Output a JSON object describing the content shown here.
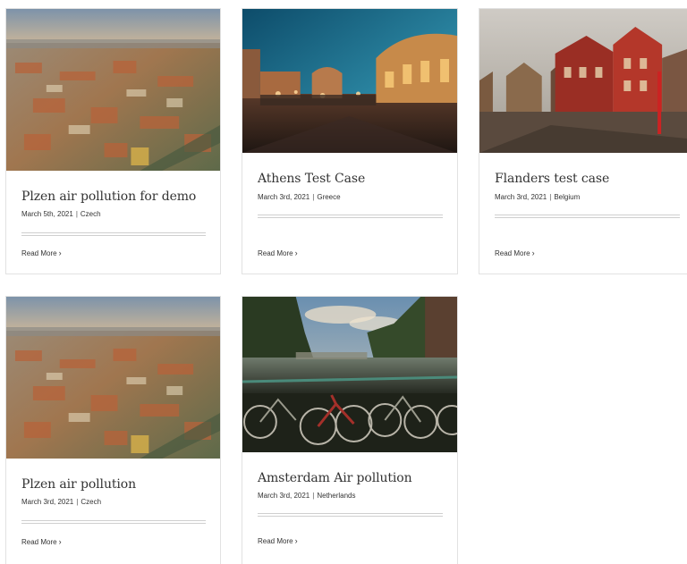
{
  "posts": [
    {
      "title": "Plzen air pollution for demo",
      "date": "March 5th, 2021",
      "category": "Czech",
      "read_more": "Read More",
      "image": "plzen-aerial-city-photo"
    },
    {
      "title": "Athens Test Case",
      "date": "March 3rd, 2021",
      "category": "Greece",
      "read_more": "Read More",
      "image": "athens-square-night-photo"
    },
    {
      "title": "Flanders test case",
      "date": "March 3rd, 2021",
      "category": "Belgium",
      "read_more": "Read More",
      "image": "flanders-street-photo"
    },
    {
      "title": "Plzen air pollution",
      "date": "March 3rd, 2021",
      "category": "Czech",
      "read_more": "Read More",
      "image": "plzen-aerial-city-photo"
    },
    {
      "title": "Amsterdam Air pollution",
      "date": "March 3rd, 2021",
      "category": "Netherlands",
      "read_more": "Read More",
      "image": "amsterdam-canal-bikes-photo"
    }
  ],
  "separator": "|",
  "chevron": "›"
}
